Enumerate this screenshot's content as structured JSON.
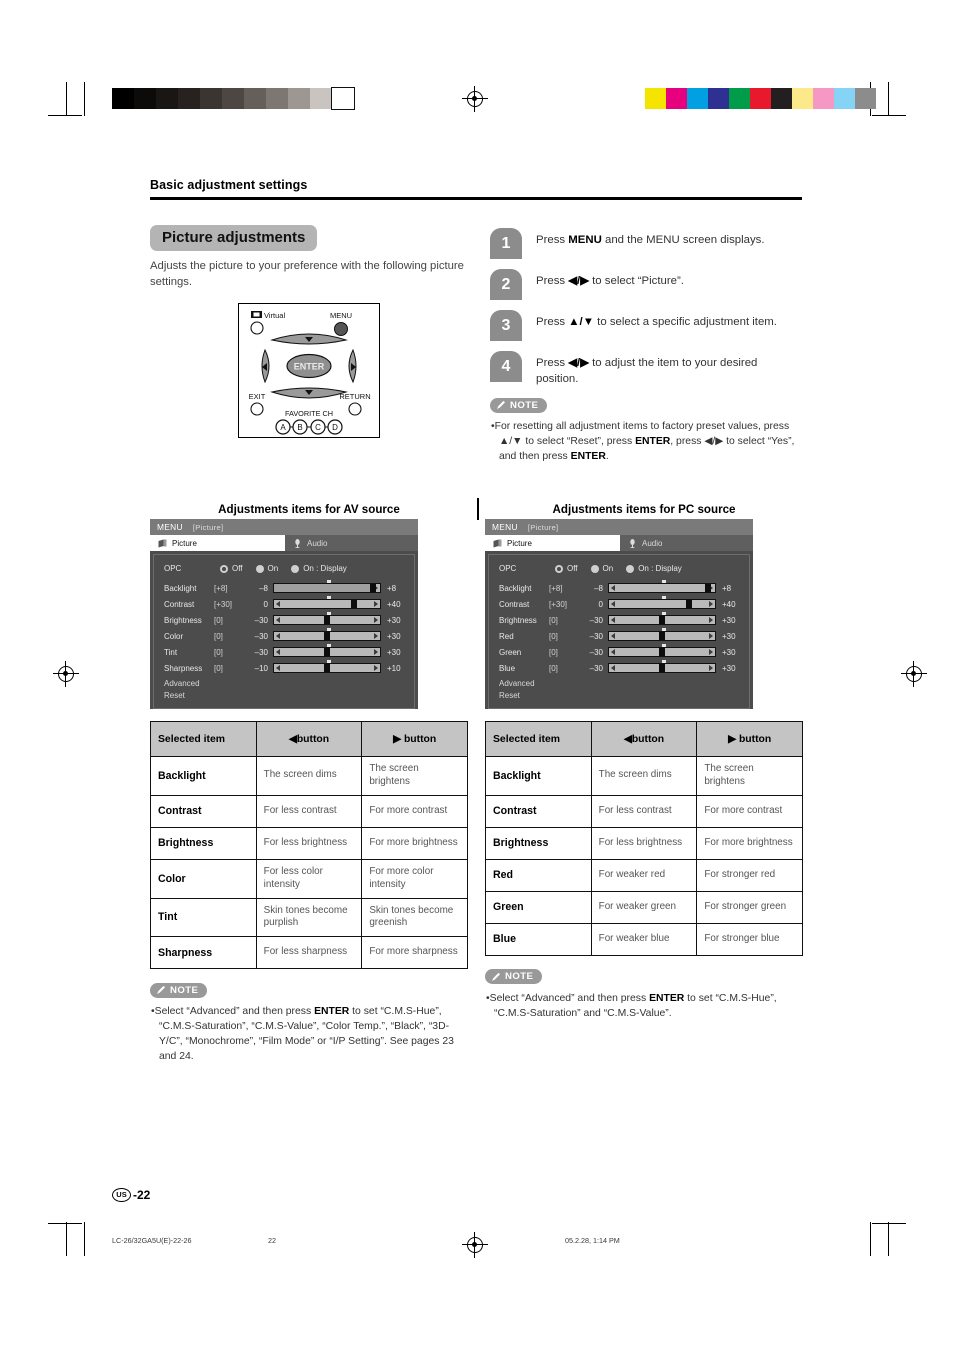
{
  "document": {
    "section_title": "Basic adjustment settings",
    "heading": "Picture adjustments",
    "lead": "Adjusts the picture to your preference with the following picture settings.",
    "page_label": "-22",
    "region_mark": "US"
  },
  "footer": {
    "filename": "LC-26/32GA5U(E)-22-26",
    "page": "22",
    "timestamp": "05.2.28, 1:14 PM"
  },
  "remote": {
    "virtual_label": "Virtual",
    "menu_label": "MENU",
    "enter_label": "ENTER",
    "exit_label": "EXIT",
    "return_label": "RETURN",
    "favorite_label": "FAVORITE CH",
    "color_buttons": [
      "A",
      "B",
      "C",
      "D"
    ]
  },
  "steps": [
    {
      "num": "1",
      "pre": "Press ",
      "strong": "MENU",
      "post": " and the MENU screen displays."
    },
    {
      "num": "2",
      "pre": "Press ",
      "strong": "◀/▶",
      "post": " to select “Picture”."
    },
    {
      "num": "3",
      "pre": "Press ",
      "strong": "▲/▼",
      "post": " to select a specific adjustment item."
    },
    {
      "num": "4",
      "pre": "Press ",
      "strong": "◀/▶",
      "post": " to adjust the item to your desired position."
    }
  ],
  "note_top": {
    "tag": "NOTE",
    "items": [
      "For resetting all adjustment items to factory preset values, press ▲/▼ to select “Reset”, press ENTER, press ◀/▶ to select “Yes”, and then press ENTER."
    ]
  },
  "av": {
    "caption": "Adjustments items for AV source",
    "osd": {
      "menu_label": "MENU",
      "menu_context": "[Picture]",
      "tab_picture": "Picture",
      "tab_audio": "Audio",
      "opc_label": "OPC",
      "opc_options": [
        "Off",
        "On",
        "On : Display"
      ],
      "opc_selected": "Off",
      "rows": [
        {
          "name": "Backlight",
          "current": "[+8]",
          "min": "–8",
          "max": "+8",
          "pos": 93,
          "style": "fill"
        },
        {
          "name": "Contrast",
          "current": "[+30]",
          "min": "0",
          "max": "+40",
          "pos": 75,
          "style": "knob"
        },
        {
          "name": "Brightness",
          "current": "[0]",
          "min": "–30",
          "max": "+30",
          "pos": 50,
          "style": "knob"
        },
        {
          "name": "Color",
          "current": "[0]",
          "min": "–30",
          "max": "+30",
          "pos": 50,
          "style": "knob"
        },
        {
          "name": "Tint",
          "current": "[0]",
          "min": "–30",
          "max": "+30",
          "pos": 50,
          "style": "knob"
        },
        {
          "name": "Sharpness",
          "current": "[0]",
          "min": "–10",
          "max": "+10",
          "pos": 50,
          "style": "knob"
        }
      ],
      "extra_rows": [
        "Advanced",
        "Reset"
      ]
    },
    "table": {
      "headers": [
        "Selected item",
        "◀button",
        "▶ button"
      ],
      "rows": [
        [
          "Backlight",
          "The screen dims",
          "The screen brightens"
        ],
        [
          "Contrast",
          "For less contrast",
          "For more contrast"
        ],
        [
          "Brightness",
          "For less brightness",
          "For more brightness"
        ],
        [
          "Color",
          "For less color intensity",
          "For more color intensity"
        ],
        [
          "Tint",
          "Skin tones become purplish",
          "Skin tones become greenish"
        ],
        [
          "Sharpness",
          "For less sharpness",
          "For more sharpness"
        ]
      ]
    },
    "note": {
      "tag": "NOTE",
      "items": [
        "Select “Advanced” and then press ENTER to set “C.M.S-Hue”, “C.M.S-Saturation”, “C.M.S-Value”, “Color Temp.”, “Black”, “3D-Y/C”, “Monochrome”, “Film Mode” or “I/P Setting”. See pages 23 and 24."
      ]
    }
  },
  "pc": {
    "caption": "Adjustments items for PC source",
    "osd": {
      "menu_label": "MENU",
      "menu_context": "[Picture]",
      "tab_picture": "Picture",
      "tab_audio": "Audio",
      "opc_label": "OPC",
      "opc_options": [
        "Off",
        "On",
        "On : Display"
      ],
      "opc_selected": "Off",
      "rows": [
        {
          "name": "Backlight",
          "current": "[+8]",
          "min": "–8",
          "max": "+8",
          "pos": 93,
          "style": "knob"
        },
        {
          "name": "Contrast",
          "current": "[+30]",
          "min": "0",
          "max": "+40",
          "pos": 75,
          "style": "knob"
        },
        {
          "name": "Brightness",
          "current": "[0]",
          "min": "–30",
          "max": "+30",
          "pos": 50,
          "style": "knob"
        },
        {
          "name": "Red",
          "current": "[0]",
          "min": "–30",
          "max": "+30",
          "pos": 50,
          "style": "knob"
        },
        {
          "name": "Green",
          "current": "[0]",
          "min": "–30",
          "max": "+30",
          "pos": 50,
          "style": "knob"
        },
        {
          "name": "Blue",
          "current": "[0]",
          "min": "–30",
          "max": "+30",
          "pos": 50,
          "style": "knob"
        }
      ],
      "extra_rows": [
        "Advanced",
        "Reset"
      ]
    },
    "table": {
      "headers": [
        "Selected item",
        "◀button",
        "▶ button"
      ],
      "rows": [
        [
          "Backlight",
          "The screen dims",
          "The screen brightens"
        ],
        [
          "Contrast",
          "For less contrast",
          "For more contrast"
        ],
        [
          "Brightness",
          "For less brightness",
          "For more brightness"
        ],
        [
          "Red",
          "For weaker red",
          "For stronger red"
        ],
        [
          "Green",
          "For weaker green",
          "For stronger green"
        ],
        [
          "Blue",
          "For weaker blue",
          "For stronger blue"
        ]
      ]
    },
    "note": {
      "tag": "NOTE",
      "items": [
        "Select “Advanced” and then press ENTER to set “C.M.S-Hue”, “C.M.S-Saturation” and “C.M.S-Value”."
      ]
    }
  },
  "print_marks": {
    "gray_strip": [
      "#000000",
      "#0d0b0a",
      "#1a1614",
      "#272220",
      "#3b3531",
      "#4d4643",
      "#665e59",
      "#7e7671",
      "#9d9691",
      "#c9c4c0",
      "#ffffff"
    ],
    "color_strip": [
      "#f5e400",
      "#e6007e",
      "#00a0e3",
      "#2e3192",
      "#009c49",
      "#e8192c",
      "#231f20",
      "#fbe98a",
      "#f599c4",
      "#85d3f5",
      "#8c8c8c"
    ]
  }
}
